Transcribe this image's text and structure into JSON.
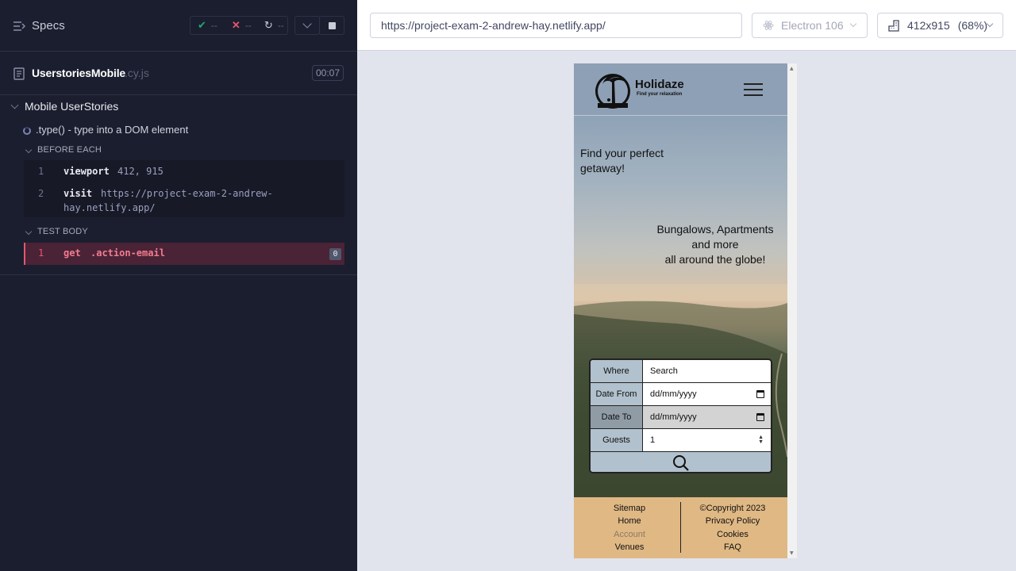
{
  "reporter": {
    "specs_label": "Specs",
    "stats": {
      "passed": "--",
      "failed": "--",
      "pending": "--"
    },
    "spec_name": "UserstoriesMobile",
    "spec_ext": ".cy.js",
    "duration": "00:07",
    "suite_title": "Mobile UserStories",
    "test_title": ".type() - type into a DOM element",
    "before_each_label": "BEFORE EACH",
    "test_body_label": "TEST BODY",
    "commands_before": [
      {
        "num": "1",
        "name": "viewport",
        "message": "412, 915"
      },
      {
        "num": "2",
        "name": "visit",
        "message_line1": "https://project-exam-2-andrew-",
        "message_line2": "hay.netlify.app/"
      }
    ],
    "commands_body": [
      {
        "num": "1",
        "name": "get",
        "message": ".action-email",
        "badge": "0"
      }
    ]
  },
  "aut": {
    "url": "https://project-exam-2-andrew-hay.netlify.app/",
    "browser": "Electron 106",
    "viewport": "412x915",
    "zoom": "(68%)"
  },
  "app": {
    "brand": "Holidaze",
    "tagline": "Find your relaxation",
    "hero_line1": "Find your perfect getaway!",
    "hero_line2a": "Bungalows, Apartments and more",
    "hero_line2b": "all around the globe!",
    "form": {
      "where_label": "Where",
      "where_placeholder": "Search",
      "date_from_label": "Date From",
      "date_from_value": "dd/mm/yyyy",
      "date_to_label": "Date To",
      "date_to_value": "dd/mm/yyyy",
      "guests_label": "Guests",
      "guests_value": "1"
    },
    "footer": {
      "left": [
        "Sitemap",
        "Home",
        "Account",
        "Venues"
      ],
      "right": [
        "©Copyright 2023",
        "Privacy Policy",
        "Cookies",
        "FAQ"
      ]
    }
  },
  "colors": {
    "reporter_bg": "#1b1e2e",
    "fail": "#e45770",
    "pass": "#1fa971",
    "footer": "#dfb884",
    "form_label": "#b1c1cd"
  }
}
